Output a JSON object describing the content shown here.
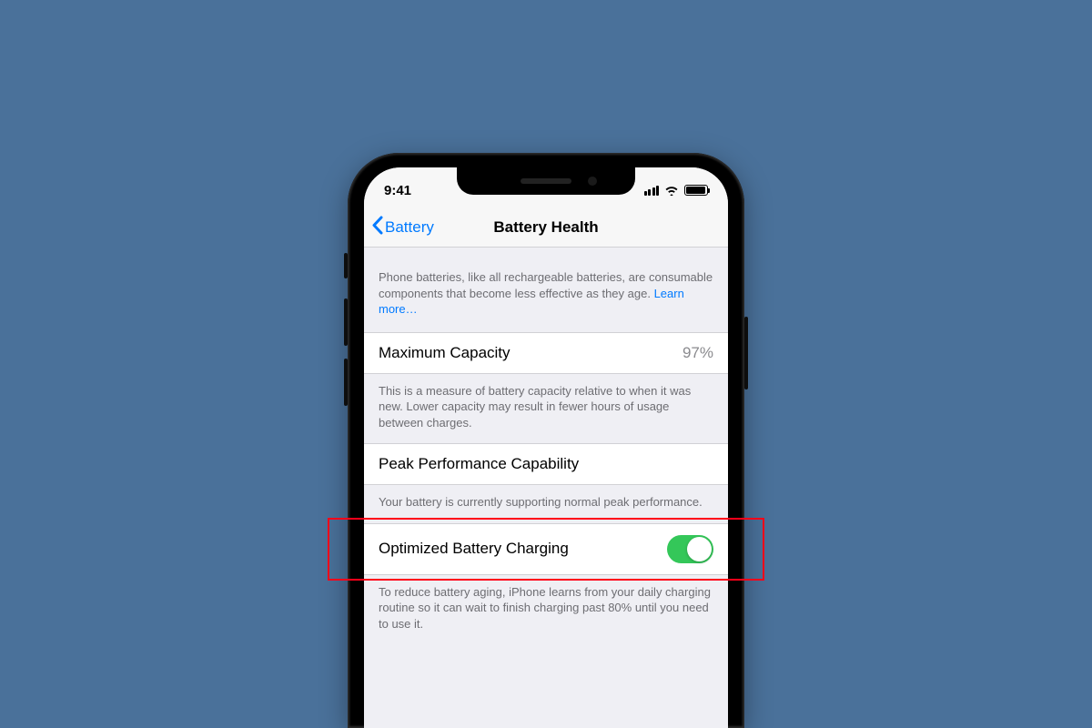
{
  "status_bar": {
    "time": "9:41"
  },
  "nav": {
    "back_label": "Battery",
    "title": "Battery Health"
  },
  "intro": {
    "text": "Phone batteries, like all rechargeable batteries, are consumable components that become less effective as they age. ",
    "link": "Learn more…"
  },
  "max_capacity": {
    "label": "Maximum Capacity",
    "value": "97%",
    "footer": "This is a measure of battery capacity relative to when it was new. Lower capacity may result in fewer hours of usage between charges."
  },
  "peak_perf": {
    "label": "Peak Performance Capability",
    "footer": "Your battery is currently supporting normal peak performance."
  },
  "optimized": {
    "label": "Optimized Battery Charging",
    "toggle_on": true,
    "footer": "To reduce battery aging, iPhone learns from your daily charging routine so it can wait to finish charging past 80% until you need to use it."
  },
  "highlight": {
    "target": "optimized-charging-row"
  }
}
